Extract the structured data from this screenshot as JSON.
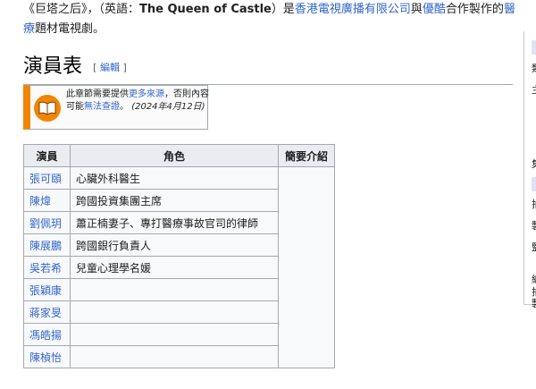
{
  "intro": {
    "part1": "《巨塔之后》，（英語：",
    "english_title": "The Queen of Castle",
    "part2": "）是",
    "link_tvb": "香港電視廣播有限公司",
    "part3": "與",
    "link_youku": "優酷",
    "part4": "合作製作的",
    "link_medical": "醫療",
    "part5": "題材電視劇。"
  },
  "section": {
    "title": "演員表",
    "edit_open": "[",
    "edit_label": "編輯",
    "edit_close": "]"
  },
  "notice": {
    "icon": "book-icon",
    "line1": "此章節需要提供",
    "link_sources": "更多來源",
    "line2": "，否則內容可能",
    "link_verify": "無法查證",
    "line3": "。",
    "date": "(2024年4月12日)"
  },
  "table": {
    "headers": [
      "演員",
      "角色",
      "簡要介紹"
    ],
    "rows": [
      {
        "actor": "張可頤",
        "role": "心臟外科醫生"
      },
      {
        "actor": "陳煒",
        "role": "跨國投資集團主席"
      },
      {
        "actor": "劉佩玥",
        "role": "蕭正楠妻子、專打醫療事故官司的律師"
      },
      {
        "actor": "陳展鵬",
        "role": "跨國銀行負責人"
      },
      {
        "actor": "吳若希",
        "role": "兒童心理學名媛"
      },
      {
        "actor": "張穎康",
        "role": ""
      },
      {
        "actor": "蔣家旻",
        "role": ""
      },
      {
        "actor": "馮皓揚",
        "role": ""
      },
      {
        "actor": "陳楨怡",
        "role": ""
      }
    ]
  },
  "sidebar": {
    "glyphs": [
      "類",
      "主",
      "集",
      "拍",
      "製",
      "監",
      "編",
      "拍",
      "製"
    ]
  },
  "colors": {
    "link": "#3366cc",
    "notice_accent": "#f28500",
    "table_border": "#a2a9b1",
    "header_bg": "#eaecf0"
  }
}
